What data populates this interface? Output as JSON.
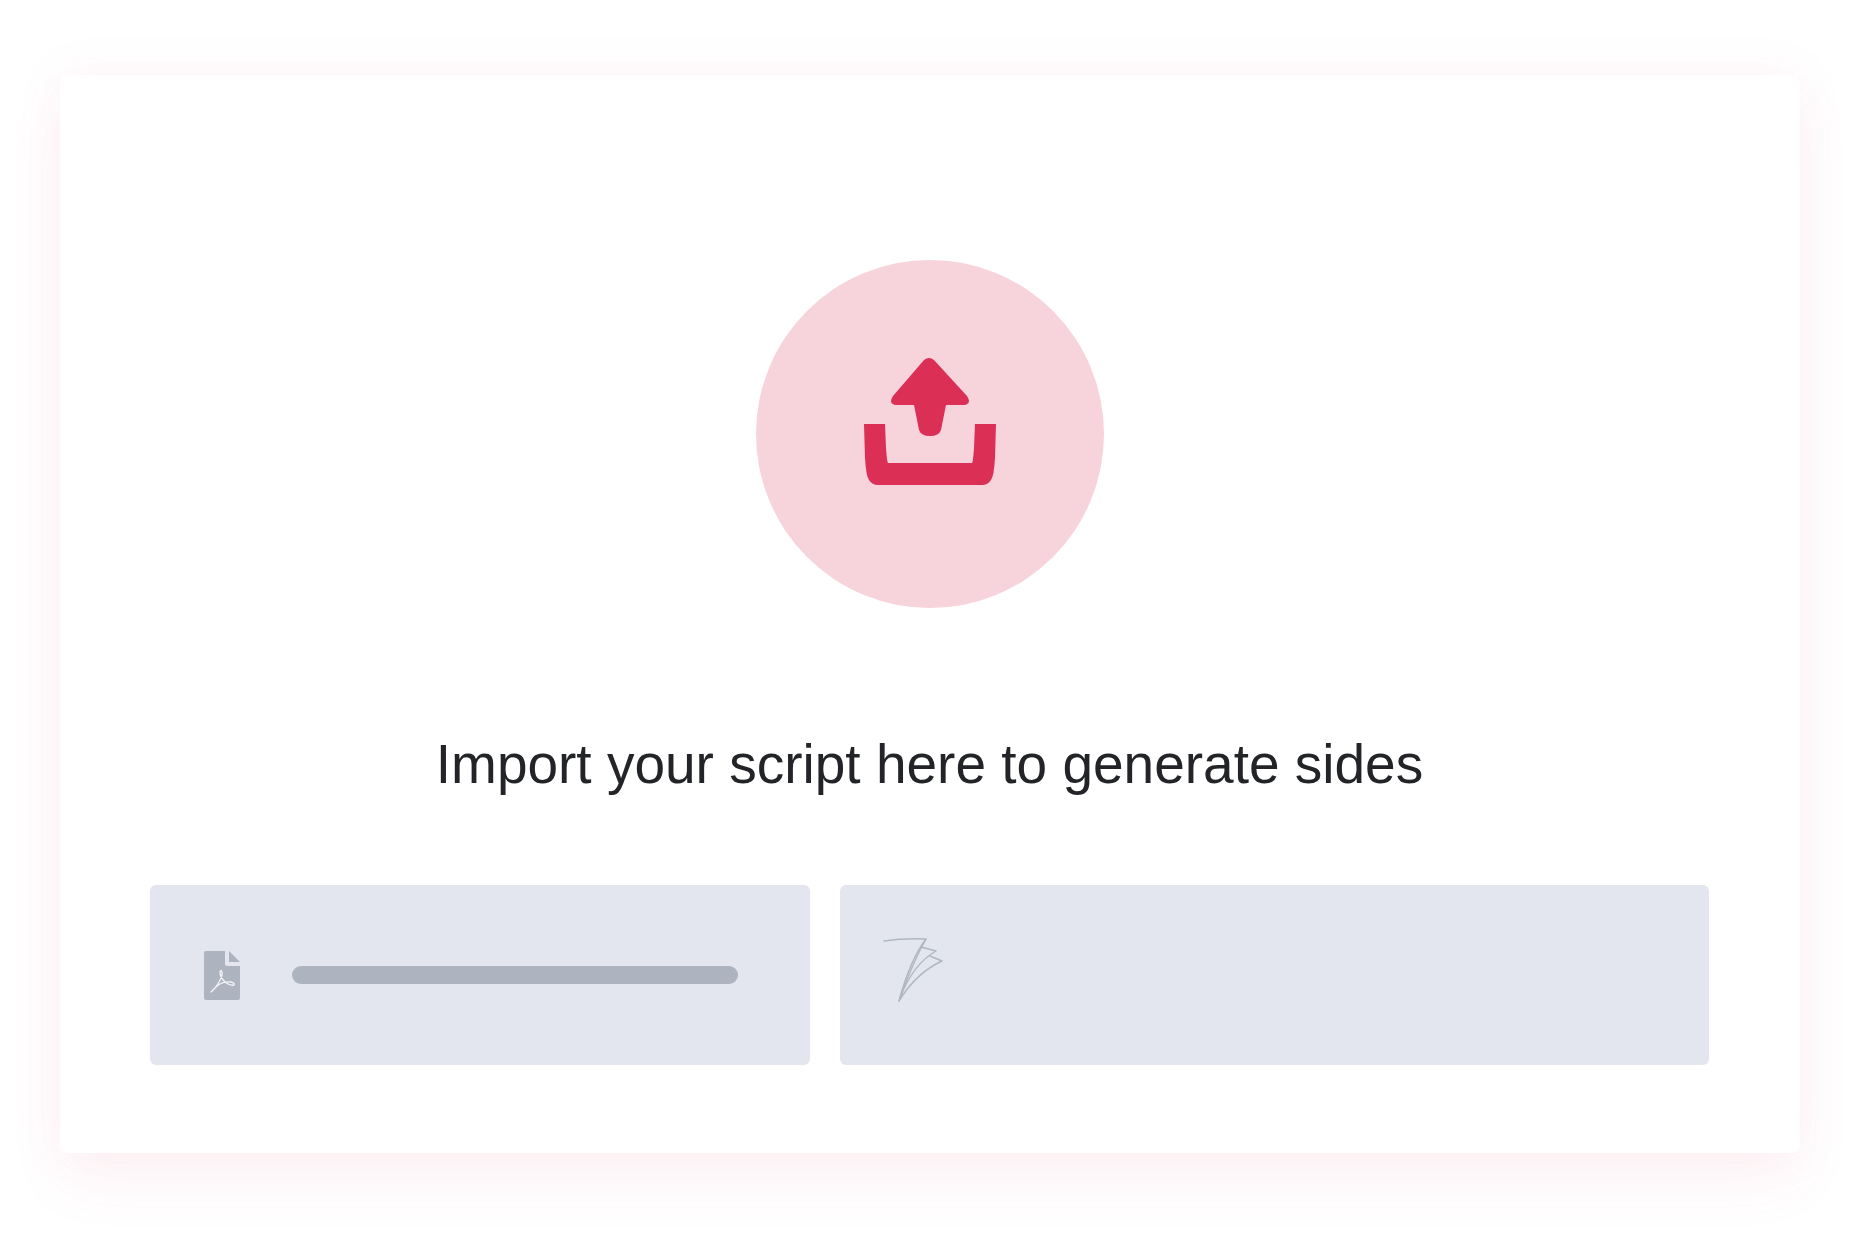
{
  "upload": {
    "heading": "Import your script here to generate sides"
  },
  "sources": [
    {
      "kind": "pdf"
    },
    {
      "kind": "logo"
    }
  ]
}
